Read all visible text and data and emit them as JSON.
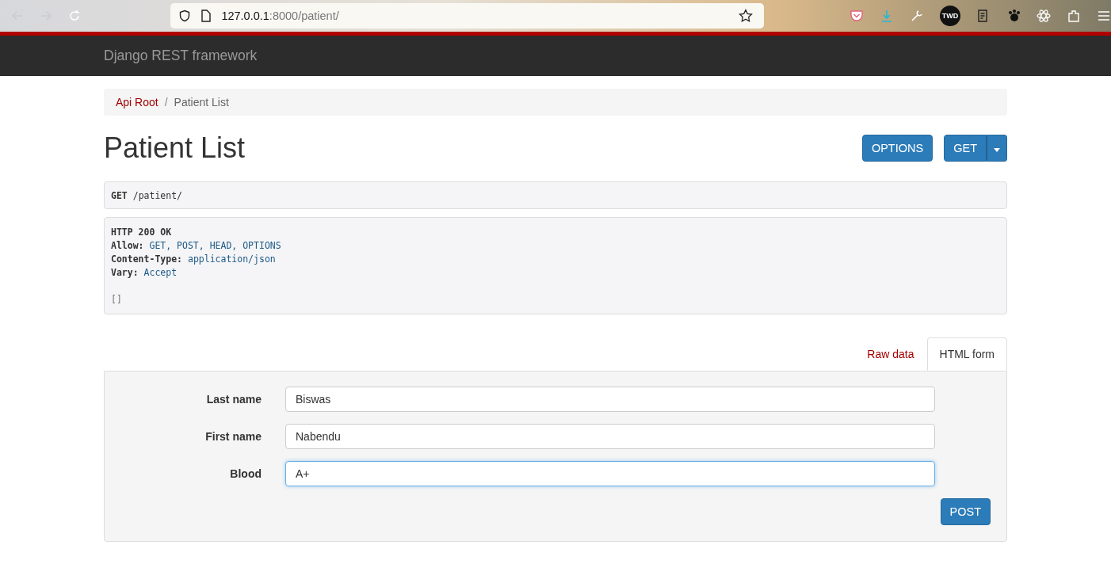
{
  "browser": {
    "url_host": "127.0.0.1",
    "url_path": ":8000/patient/",
    "extension_badge": "TWD"
  },
  "navbar": {
    "brand": "Django REST framework"
  },
  "breadcrumb_separator": "/",
  "breadcrumb": [
    {
      "label": "Api Root",
      "link": true
    },
    {
      "label": "Patient List",
      "link": false
    }
  ],
  "page": {
    "title": "Patient List",
    "buttons": [
      "OPTIONS",
      "GET"
    ]
  },
  "request": {
    "method": "GET",
    "path": "/patient/"
  },
  "response": {
    "status": "HTTP 200 OK",
    "headers": [
      {
        "name": "Allow:",
        "value": "GET, POST, HEAD, OPTIONS"
      },
      {
        "name": "Content-Type:",
        "value": "application/json"
      },
      {
        "name": "Vary:",
        "value": "Accept"
      }
    ],
    "body": "[]"
  },
  "form_tabs": [
    {
      "label": "Raw data",
      "selected": false
    },
    {
      "label": "HTML form",
      "selected": true
    }
  ],
  "form": {
    "fields": [
      {
        "label": "Last name",
        "value": "Biswas",
        "focused": false
      },
      {
        "label": "First name",
        "value": "Nabendu",
        "focused": false
      },
      {
        "label": "Blood",
        "value": "A+",
        "focused": true
      }
    ],
    "submit": "POST"
  }
}
